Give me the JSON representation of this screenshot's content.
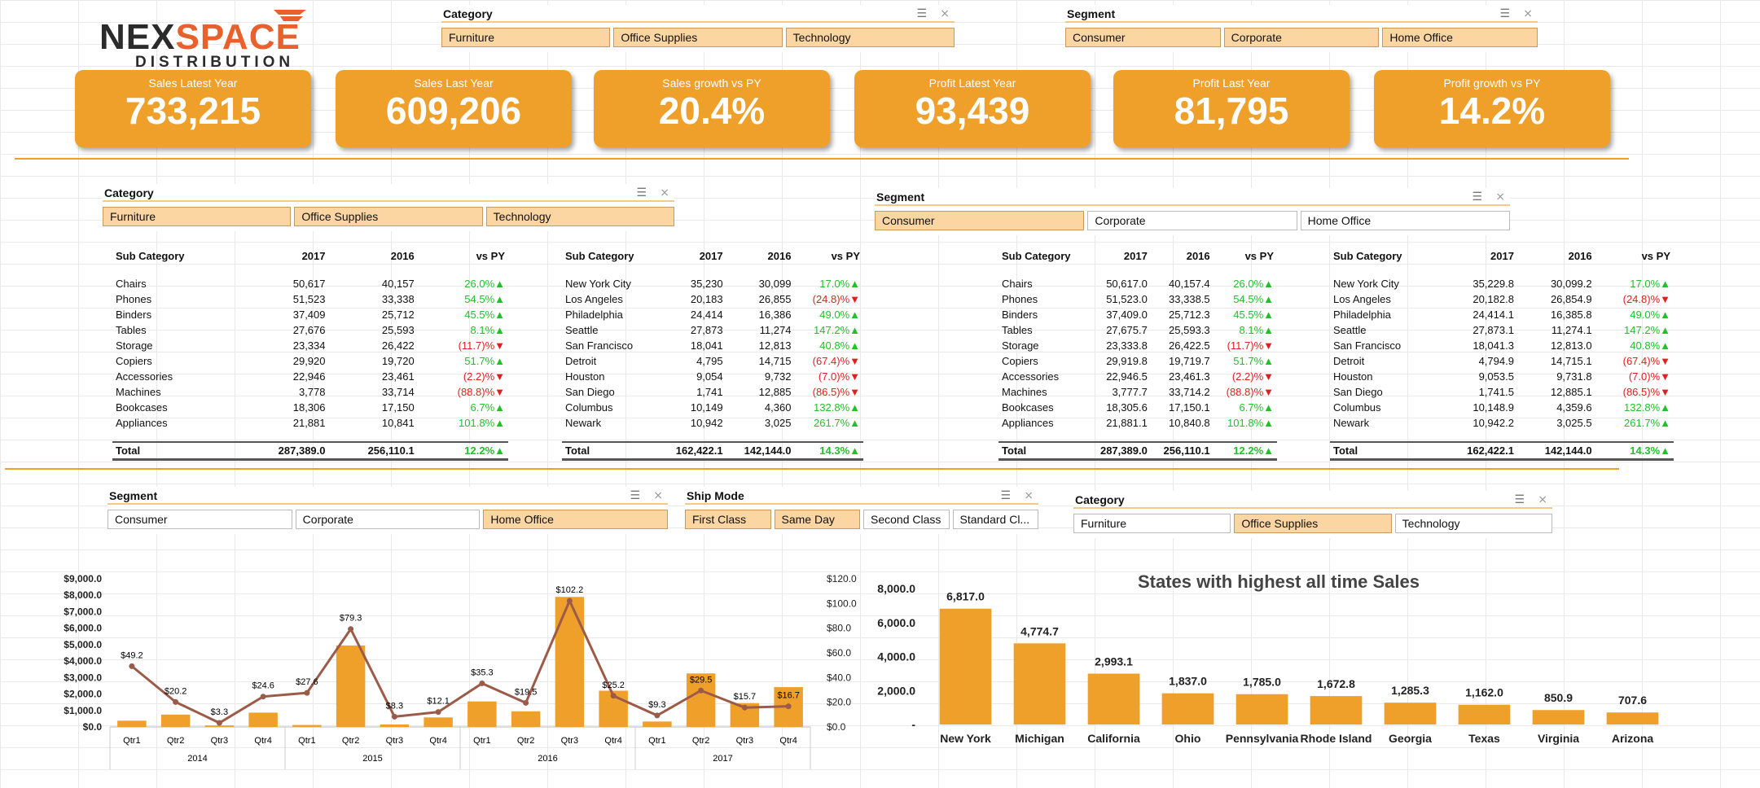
{
  "logo": {
    "word1": "NEX",
    "word2": "SPACE",
    "sub": "DISTRIBUTION"
  },
  "top_category_slicer": {
    "title": "Category",
    "items": [
      {
        "label": "Furniture",
        "selected": true
      },
      {
        "label": "Office Supplies",
        "selected": true
      },
      {
        "label": "Technology",
        "selected": true
      }
    ]
  },
  "top_segment_slicer": {
    "title": "Segment",
    "items": [
      {
        "label": "Consumer",
        "selected": true
      },
      {
        "label": "Corporate",
        "selected": true
      },
      {
        "label": "Home Office",
        "selected": true
      }
    ]
  },
  "kpis": [
    {
      "label": "Sales Latest Year",
      "value": "733,215"
    },
    {
      "label": "Sales Last Year",
      "value": "609,206"
    },
    {
      "label": "Sales growth vs PY",
      "value": "20.4%"
    },
    {
      "label": "Profit Latest Year",
      "value": "93,439"
    },
    {
      "label": "Profit Last Year",
      "value": "81,795"
    },
    {
      "label": "Profit growth vs PY",
      "value": "14.2%"
    }
  ],
  "mid_category_slicer": {
    "title": "Category",
    "items": [
      {
        "label": "Furniture",
        "selected": true
      },
      {
        "label": "Office Supplies",
        "selected": true
      },
      {
        "label": "Technology",
        "selected": true
      }
    ]
  },
  "mid_segment_slicer": {
    "title": "Segment",
    "items": [
      {
        "label": "Consumer",
        "selected": true
      },
      {
        "label": "Corporate",
        "selected": false
      },
      {
        "label": "Home Office",
        "selected": false
      }
    ]
  },
  "tables": [
    {
      "headers": [
        "Sub Category",
        "2017",
        "2016",
        "vs PY"
      ],
      "rows": [
        [
          "Chairs",
          "50,617",
          "40,157",
          "26.0%▲",
          "pos"
        ],
        [
          "Phones",
          "51,523",
          "33,338",
          "54.5%▲",
          "pos"
        ],
        [
          "Binders",
          "37,409",
          "25,712",
          "45.5%▲",
          "pos"
        ],
        [
          "Tables",
          "27,676",
          "25,593",
          "8.1%▲",
          "pos"
        ],
        [
          "Storage",
          "23,334",
          "26,422",
          "(11.7)%▼",
          "neg"
        ],
        [
          "Copiers",
          "29,920",
          "19,720",
          "51.7%▲",
          "pos"
        ],
        [
          "Accessories",
          "22,946",
          "23,461",
          "(2.2)%▼",
          "neg"
        ],
        [
          "Machines",
          "3,778",
          "33,714",
          "(88.8)%▼",
          "neg"
        ],
        [
          "Bookcases",
          "18,306",
          "17,150",
          "6.7%▲",
          "pos"
        ],
        [
          "Appliances",
          "21,881",
          "10,841",
          "101.8%▲",
          "pos"
        ]
      ],
      "total": [
        "Total",
        "287,389.0",
        "256,110.1",
        "12.2%▲",
        "pos"
      ]
    },
    {
      "headers": [
        "Sub Category",
        "2017",
        "2016",
        "vs PY"
      ],
      "rows": [
        [
          "New York City",
          "35,230",
          "30,099",
          "17.0%▲",
          "pos"
        ],
        [
          "Los Angeles",
          "20,183",
          "26,855",
          "(24.8)%▼",
          "neg"
        ],
        [
          "Philadelphia",
          "24,414",
          "16,386",
          "49.0%▲",
          "pos"
        ],
        [
          "Seattle",
          "27,873",
          "11,274",
          "147.2%▲",
          "pos"
        ],
        [
          "San Francisco",
          "18,041",
          "12,813",
          "40.8%▲",
          "pos"
        ],
        [
          "Detroit",
          "4,795",
          "14,715",
          "(67.4)%▼",
          "neg"
        ],
        [
          "Houston",
          "9,054",
          "9,732",
          "(7.0)%▼",
          "neg"
        ],
        [
          "San Diego",
          "1,741",
          "12,885",
          "(86.5)%▼",
          "neg"
        ],
        [
          "Columbus",
          "10,149",
          "4,360",
          "132.8%▲",
          "pos"
        ],
        [
          "Newark",
          "10,942",
          "3,025",
          "261.7%▲",
          "pos"
        ]
      ],
      "total": [
        "Total",
        "162,422.1",
        "142,144.0",
        "14.3%▲",
        "pos"
      ]
    },
    {
      "headers": [
        "Sub Category",
        "2017",
        "2016",
        "vs PY"
      ],
      "rows": [
        [
          "Chairs",
          "50,617.0",
          "40,157.4",
          "26.0%▲",
          "pos"
        ],
        [
          "Phones",
          "51,523.0",
          "33,338.5",
          "54.5%▲",
          "pos"
        ],
        [
          "Binders",
          "37,409.0",
          "25,712.3",
          "45.5%▲",
          "pos"
        ],
        [
          "Tables",
          "27,675.7",
          "25,593.3",
          "8.1%▲",
          "pos"
        ],
        [
          "Storage",
          "23,333.8",
          "26,422.5",
          "(11.7)%▼",
          "neg"
        ],
        [
          "Copiers",
          "29,919.8",
          "19,719.7",
          "51.7%▲",
          "pos"
        ],
        [
          "Accessories",
          "22,946.5",
          "23,461.3",
          "(2.2)%▼",
          "neg"
        ],
        [
          "Machines",
          "3,777.7",
          "33,714.2",
          "(88.8)%▼",
          "neg"
        ],
        [
          "Bookcases",
          "18,305.6",
          "17,150.1",
          "6.7%▲",
          "pos"
        ],
        [
          "Appliances",
          "21,881.1",
          "10,840.8",
          "101.8%▲",
          "pos"
        ]
      ],
      "total": [
        "Total",
        "287,389.0",
        "256,110.1",
        "12.2%▲",
        "pos"
      ]
    },
    {
      "headers": [
        "Sub Category",
        "2017",
        "2016",
        "vs PY"
      ],
      "rows": [
        [
          "New York City",
          "35,229.8",
          "30,099.2",
          "17.0%▲",
          "pos"
        ],
        [
          "Los Angeles",
          "20,182.8",
          "26,854.9",
          "(24.8)%▼",
          "neg"
        ],
        [
          "Philadelphia",
          "24,414.1",
          "16,385.8",
          "49.0%▲",
          "pos"
        ],
        [
          "Seattle",
          "27,873.1",
          "11,274.1",
          "147.2%▲",
          "pos"
        ],
        [
          "San Francisco",
          "18,041.3",
          "12,813.0",
          "40.8%▲",
          "pos"
        ],
        [
          "Detroit",
          "4,794.9",
          "14,715.1",
          "(67.4)%▼",
          "neg"
        ],
        [
          "Houston",
          "9,053.5",
          "9,731.8",
          "(7.0)%▼",
          "neg"
        ],
        [
          "San Diego",
          "1,741.5",
          "12,885.1",
          "(86.5)%▼",
          "neg"
        ],
        [
          "Columbus",
          "10,148.9",
          "4,359.6",
          "132.8%▲",
          "pos"
        ],
        [
          "Newark",
          "10,942.2",
          "3,025.5",
          "261.7%▲",
          "pos"
        ]
      ],
      "total": [
        "Total",
        "162,422.1",
        "142,144.0",
        "14.3%▲",
        "pos"
      ]
    }
  ],
  "bottom_segment_slicer": {
    "title": "Segment",
    "items": [
      {
        "label": "Consumer",
        "selected": false
      },
      {
        "label": "Corporate",
        "selected": false
      },
      {
        "label": "Home Office",
        "selected": true
      }
    ]
  },
  "shipmode_slicer": {
    "title": "Ship Mode",
    "items": [
      {
        "label": "First Class",
        "selected": true
      },
      {
        "label": "Same Day",
        "selected": true
      },
      {
        "label": "Second Class",
        "selected": false
      },
      {
        "label": "Standard Cl...",
        "selected": false
      }
    ]
  },
  "bottom_category_slicer": {
    "title": "Category",
    "items": [
      {
        "label": "Furniture",
        "selected": false
      },
      {
        "label": "Office Supplies",
        "selected": true
      },
      {
        "label": "Technology",
        "selected": false
      }
    ]
  },
  "chart_data": [
    {
      "type": "bar",
      "combo_line": true,
      "categories": [
        "Qtr1",
        "Qtr2",
        "Qtr3",
        "Qtr4",
        "Qtr1",
        "Qtr2",
        "Qtr3",
        "Qtr4",
        "Qtr1",
        "Qtr2",
        "Qtr3",
        "Qtr4",
        "Qtr1",
        "Qtr2",
        "Qtr3",
        "Qtr4"
      ],
      "groups": [
        "2014",
        "2015",
        "2016",
        "2017"
      ],
      "bar_values": [
        380,
        750,
        90,
        870,
        120,
        4950,
        150,
        580,
        1550,
        950,
        7900,
        2200,
        330,
        3250,
        1450,
        2420
      ],
      "line_values": [
        49.2,
        20.2,
        3.3,
        24.6,
        27.6,
        79.3,
        8.3,
        12.1,
        35.3,
        19.5,
        102.2,
        25.2,
        9.3,
        29.5,
        15.7,
        16.7
      ],
      "line_labels": [
        "$49.2",
        "$20.2",
        "$3.3",
        "$24.6",
        "$27.6",
        "$79.3",
        "$8.3",
        "$12.1",
        "$35.3",
        "$19.5",
        "$102.2",
        "$25.2",
        "$9.3",
        "$29.5",
        "$15.7",
        "$16.7"
      ],
      "ylim": [
        0,
        9000
      ],
      "y2lim": [
        0,
        120
      ],
      "yticks": [
        "$0.0",
        "$1,000.0",
        "$2,000.0",
        "$3,000.0",
        "$4,000.0",
        "$5,000.0",
        "$6,000.0",
        "$7,000.0",
        "$8,000.0",
        "$9,000.0"
      ],
      "y2ticks": [
        "$0.0",
        "$20.0",
        "$40.0",
        "$60.0",
        "$80.0",
        "$100.0",
        "$120.0"
      ],
      "bar_color": "#efa02b",
      "line_color": "#9c5a48"
    },
    {
      "type": "bar",
      "title": "States with highest all time Sales",
      "categories": [
        "New York",
        "Michigan",
        "California",
        "Ohio",
        "Pennsylvania",
        "Rhode Island",
        "Georgia",
        "Texas",
        "Virginia",
        "Arizona"
      ],
      "values": [
        6817.0,
        4774.7,
        2993.1,
        1837.0,
        1785.0,
        1672.8,
        1285.3,
        1162.0,
        850.9,
        707.6
      ],
      "value_labels": [
        "6,817.0",
        "4,774.7",
        "2,993.1",
        "1,837.0",
        "1,785.0",
        "1,672.8",
        "1,285.3",
        "1,162.0",
        "850.9",
        "707.6"
      ],
      "ylim": [
        0,
        8000
      ],
      "yticks": [
        "-",
        "2,000.0",
        "4,000.0",
        "6,000.0",
        "8,000.0"
      ],
      "bar_color": "#efa02b"
    }
  ]
}
